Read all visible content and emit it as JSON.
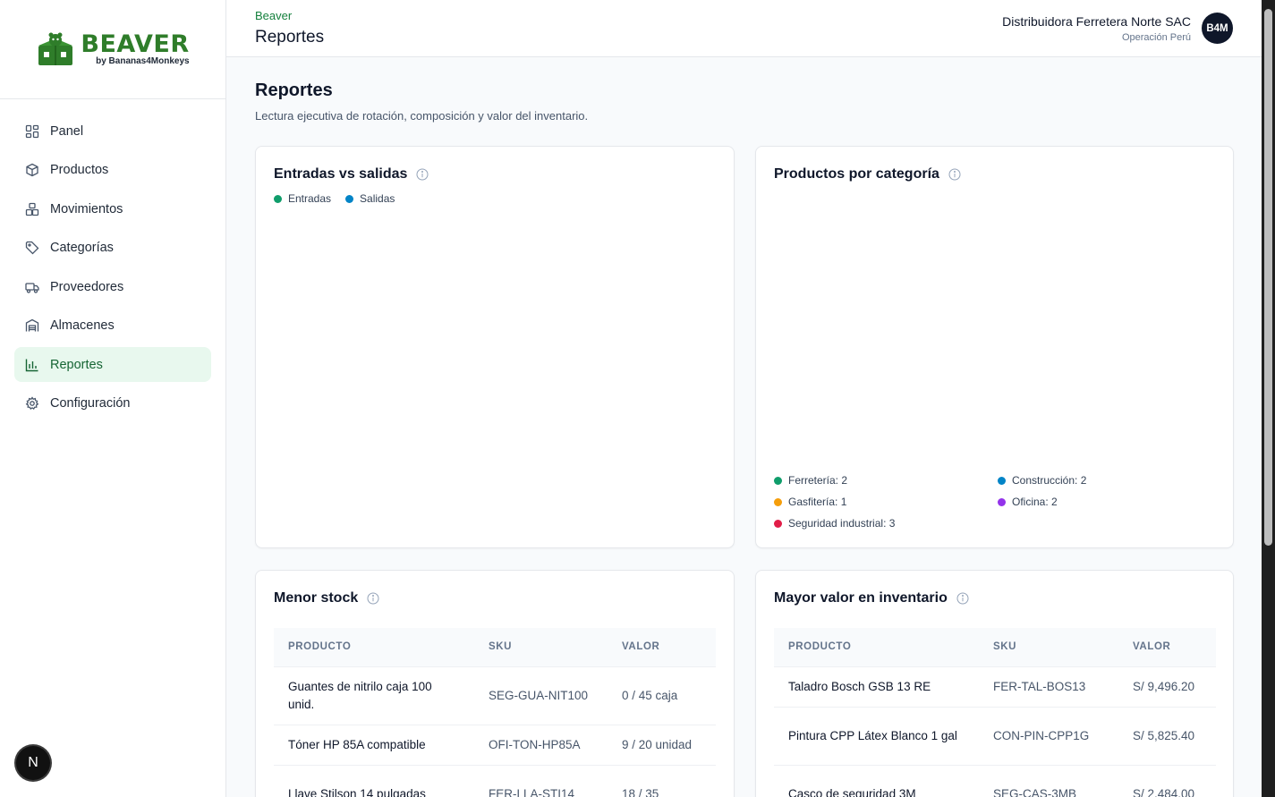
{
  "brand": {
    "name": "BEAVER",
    "byline": "by Bananas4Monkeys",
    "accent": "#2f7d2a"
  },
  "sidebar": {
    "items": [
      {
        "label": "Panel",
        "icon": "grid-icon"
      },
      {
        "label": "Productos",
        "icon": "box-icon"
      },
      {
        "label": "Movimientos",
        "icon": "boxes-icon"
      },
      {
        "label": "Categorías",
        "icon": "tag-icon"
      },
      {
        "label": "Proveedores",
        "icon": "truck-icon"
      },
      {
        "label": "Almacenes",
        "icon": "warehouse-icon"
      },
      {
        "label": "Reportes",
        "icon": "bar-chart-icon",
        "active": true
      },
      {
        "label": "Configuración",
        "icon": "gear-icon"
      }
    ]
  },
  "header": {
    "breadcrumb": "Beaver",
    "title": "Reportes",
    "company_name": "Distribuidora Ferretera Norte SAC",
    "company_sub": "Operación Perú",
    "avatar": "B4M"
  },
  "main": {
    "title": "Reportes",
    "description": "Lectura ejecutiva de rotación, composición y valor del inventario."
  },
  "cards": {
    "flows": {
      "title": "Entradas vs salidas",
      "legend": [
        {
          "label": "Entradas",
          "color": "#16a34a"
        },
        {
          "label": "Salidas",
          "color": "#0891b2"
        }
      ]
    },
    "categories": {
      "title": "Productos por categoría",
      "legend": [
        {
          "label": "Ferretería: 2",
          "color": "#0f9d6b"
        },
        {
          "label": "Construcción: 2",
          "color": "#0284c7"
        },
        {
          "label": "Gasfitería: 1",
          "color": "#f59e0b"
        },
        {
          "label": "Oficina: 2",
          "color": "#9333ea"
        },
        {
          "label": "Seguridad industrial: 3",
          "color": "#e11d48"
        }
      ]
    },
    "low_stock": {
      "title": "Menor stock",
      "columns": [
        "PRODUCTO",
        "SKU",
        "VALOR"
      ],
      "rows": [
        {
          "product": "Guantes de nitrilo caja 100 unid.",
          "sku": "SEG-GUA-NIT100",
          "value": "0 / 45 caja"
        },
        {
          "product": "Tóner HP 85A compatible",
          "sku": "OFI-TON-HP85A",
          "value": "9 / 20 unidad"
        },
        {
          "product": "Llave Stilson 14 pulgadas",
          "sku": "FER-LLA-STI14",
          "value": "18 / 35"
        }
      ]
    },
    "top_value": {
      "title": "Mayor valor en inventario",
      "columns": [
        "PRODUCTO",
        "SKU",
        "VALOR"
      ],
      "rows": [
        {
          "product": "Taladro Bosch GSB 13 RE",
          "sku": "FER-TAL-BOS13",
          "value": "S/ 9,496.20"
        },
        {
          "product": "Pintura CPP Látex Blanco 1 gal",
          "sku": "CON-PIN-CPP1G",
          "value": "S/ 5,825.40"
        },
        {
          "product": "Casco de seguridad 3M",
          "sku": "SEG-CAS-3MB",
          "value": "S/ 2,484.00"
        }
      ]
    }
  },
  "dev_badge": "N"
}
